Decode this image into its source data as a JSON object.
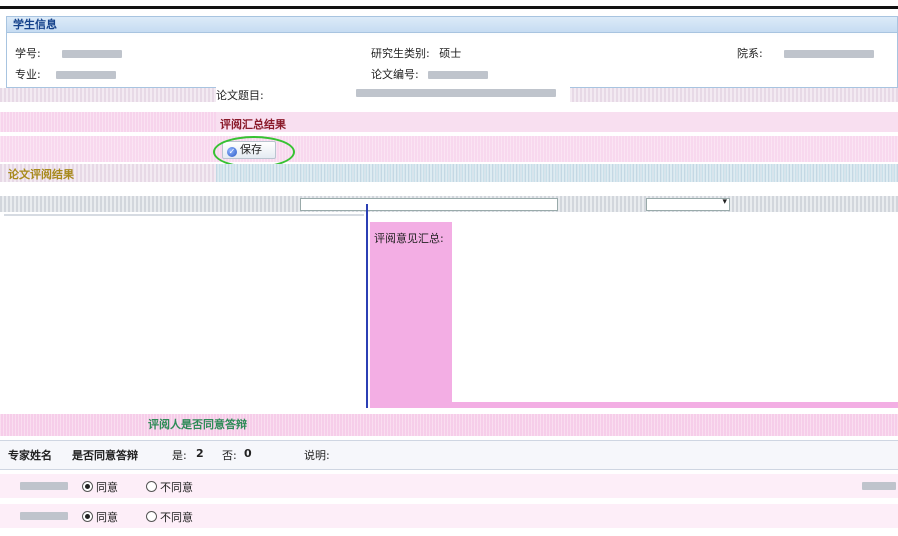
{
  "student_info": {
    "panel_title": "学生信息",
    "student_no_label": "学号:",
    "major_label": "专业:",
    "grad_type_label": "研究生类别:",
    "grad_type_value": "硕士",
    "thesis_no_label": "论文编号:",
    "department_label": "院系:"
  },
  "thesis": {
    "title_label": "论文题目:"
  },
  "summary": {
    "section_title": "评阅汇总结果",
    "save_label": "保存",
    "comments_label": "评阅意见汇总:"
  },
  "left_panel": {
    "title": "论文评阅结果"
  },
  "defense": {
    "section_title": "评阅人是否同意答辩",
    "expert_name_header": "专家姓名",
    "agree_header": "是否同意答辩",
    "yes_label": "是:",
    "yes_count": "2",
    "no_label": "否:",
    "no_count": "0",
    "note_label": "说明:",
    "rows": [
      {
        "agree": "同意",
        "disagree": "不同意",
        "selected": "agree"
      },
      {
        "agree": "同意",
        "disagree": "不同意",
        "selected": "agree"
      }
    ]
  },
  "colors": {
    "header_blue": "#15428b",
    "highlight_green": "#37c232",
    "summary_title": "#8a1a2a",
    "comments_pink": "#f2b0e6"
  }
}
